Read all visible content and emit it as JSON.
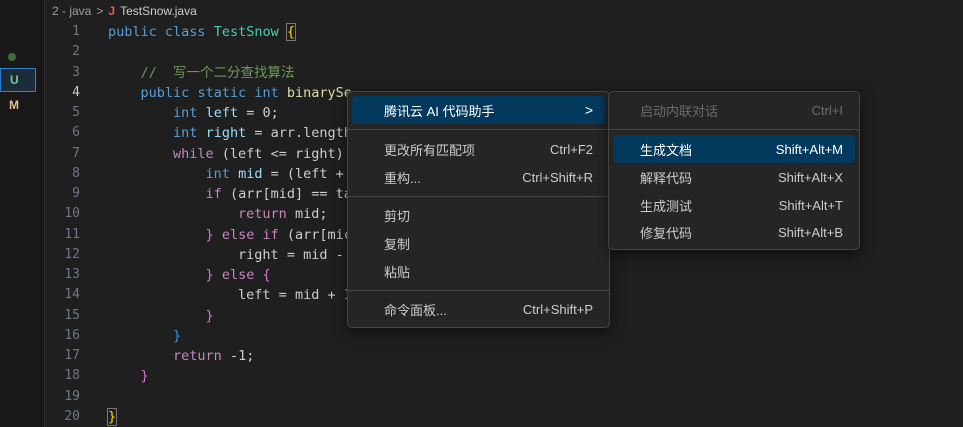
{
  "breadcrumb": {
    "folder": "2 - java",
    "sep": ">",
    "file_icon": "J",
    "file": "TestSnow.java"
  },
  "gutter": {
    "u": "U",
    "m": "M"
  },
  "lines": [
    "1",
    "2",
    "3",
    "4",
    "5",
    "6",
    "7",
    "8",
    "9",
    "10",
    "11",
    "12",
    "13",
    "14",
    "15",
    "16",
    "17",
    "18",
    "19",
    "20"
  ],
  "code": {
    "l1_kw1": "public",
    "l1_kw2": "class",
    "l1_cls": "TestSnow",
    "l1_brace": "{",
    "l3_cm": "//  写一个二分查找算法",
    "l4_kw1": "public",
    "l4_kw2": "static",
    "l4_ty": "int",
    "l4_fn": "binarySe",
    "l5_ty": "int",
    "l5_var": "left",
    "l5_rest": " = 0;",
    "l6_ty": "int",
    "l6_var": "right",
    "l6_rest": " = arr.length",
    "l7_kw": "while",
    "l7_rest": " (left <= right)",
    "l8_ty": "int",
    "l8_var": "mid",
    "l8_rest": " = (left +",
    "l9_kw": "if",
    "l9_rest": " (arr[mid] == ta",
    "l10_kw": "return",
    "l10_rest": " mid;",
    "l11_brace": "}",
    "l11_kw": " else if",
    "l11_rest": " (arr[mic",
    "l12_rest": "right = mid -",
    "l13_brace": "}",
    "l13_kw": " else",
    "l13_brace2": " {",
    "l14_rest": "left = mid + 1",
    "l15_brace": "}",
    "l16_brace": "}",
    "l17_kw": "return",
    "l17_rest": " -1;",
    "l18_brace": "}",
    "l20_brace": "}"
  },
  "context_menu": {
    "items": [
      {
        "label": "腾讯云 AI 代码助手",
        "shortcut": "",
        "submenu": true
      },
      {
        "label": "更改所有匹配项",
        "shortcut": "Ctrl+F2"
      },
      {
        "label": "重构...",
        "shortcut": "Ctrl+Shift+R"
      },
      {
        "label": "剪切",
        "shortcut": ""
      },
      {
        "label": "复制",
        "shortcut": ""
      },
      {
        "label": "粘贴",
        "shortcut": ""
      },
      {
        "label": "命令面板...",
        "shortcut": "Ctrl+Shift+P"
      }
    ],
    "submenu_chevron": ">"
  },
  "submenu": {
    "items": [
      {
        "label": "启动内联对话",
        "shortcut": "Ctrl+I"
      },
      {
        "label": "生成文档",
        "shortcut": "Shift+Alt+M"
      },
      {
        "label": "解释代码",
        "shortcut": "Shift+Alt+X"
      },
      {
        "label": "生成测试",
        "shortcut": "Shift+Alt+T"
      },
      {
        "label": "修复代码",
        "shortcut": "Shift+Alt+B"
      }
    ]
  },
  "colors": {
    "selection": "#04395e",
    "editor_bg": "#1f1f1f",
    "keyword": "#569cd6"
  }
}
